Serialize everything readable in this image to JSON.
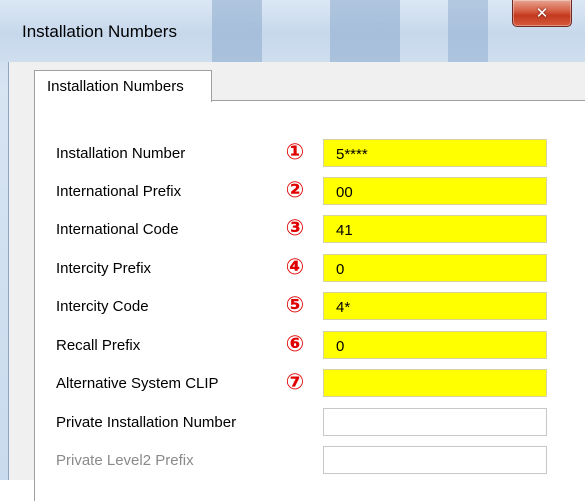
{
  "window": {
    "title": "Installation Numbers",
    "close_icon": "x-close-icon"
  },
  "tabs": [
    {
      "label": "Installation Numbers",
      "active": true
    }
  ],
  "fields": [
    {
      "label": "Installation Number",
      "marker": "①",
      "value": "5****",
      "highlighted": true,
      "enabled": true
    },
    {
      "label": "International Prefix",
      "marker": "②",
      "value": "00",
      "highlighted": true,
      "enabled": true
    },
    {
      "label": "International Code",
      "marker": "③",
      "value": "41",
      "highlighted": true,
      "enabled": true
    },
    {
      "label": "Intercity Prefix",
      "marker": "④",
      "value": "0",
      "highlighted": true,
      "enabled": true
    },
    {
      "label": "Intercity Code",
      "marker": "⑤",
      "value": "4*",
      "highlighted": true,
      "enabled": true
    },
    {
      "label": "Recall Prefix",
      "marker": "⑥",
      "value": "0",
      "highlighted": true,
      "enabled": true
    },
    {
      "label": "Alternative System CLIP",
      "marker": "⑦",
      "value": "",
      "highlighted": true,
      "enabled": true
    },
    {
      "label": "Private Installation Number",
      "marker": "",
      "value": "",
      "highlighted": false,
      "enabled": true
    },
    {
      "label": "Private Level2 Prefix",
      "marker": "",
      "value": "",
      "highlighted": false,
      "enabled": false
    }
  ],
  "colors": {
    "highlight": "#ffff00",
    "marker": "#e00000",
    "close_button": "#c23a1f"
  }
}
